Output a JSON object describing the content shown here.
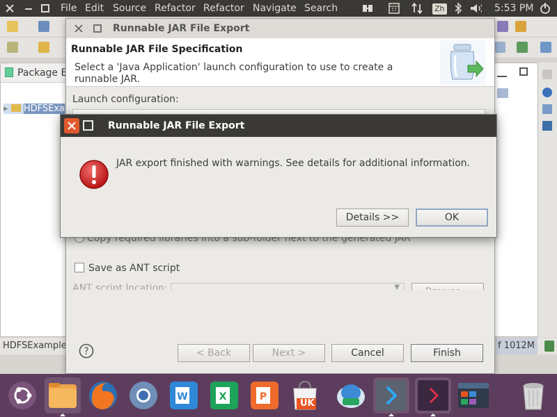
{
  "panel": {
    "menus": [
      "File",
      "Edit",
      "Source",
      "Refactor",
      "Refactor",
      "Navigate",
      "Search"
    ],
    "keyboard_layout": "Zh",
    "time": "5:53 PM",
    "indicator_icons": [
      "connect-icon",
      "calendar-icon",
      "network-arrows-icon",
      "keyboard-icon",
      "bluetooth-icon",
      "volume-icon",
      "power-icon"
    ]
  },
  "eclipse": {
    "package_explorer_tab": "Package E",
    "project_item": "HDFSExa",
    "status_left": "HDFSExample",
    "status_memory": "f 1012M"
  },
  "wizard": {
    "title": "Runnable JAR File Export",
    "heading": "Runnable JAR File Specification",
    "description": "Select a 'Java Application' launch configuration to use to create a runnable JAR.",
    "launch_config_label": "Launch configuration:",
    "copy_libs_radio": "Copy required libraries into a sub-folder next to the generated JAR",
    "save_ant_label": "Save as ANT script",
    "ant_location_label": "ANT script location:",
    "browse_label": "Browse...",
    "back_label": "< Back",
    "next_label": "Next >",
    "cancel_label": "Cancel",
    "finish_label": "Finish"
  },
  "message": {
    "title": "Runnable JAR File Export",
    "text": "JAR export finished with warnings. See details for additional information.",
    "details_label": "Details >>",
    "ok_label": "OK",
    "icon": "error-icon"
  },
  "dock": {
    "badge_text": "UK",
    "apps": [
      "ubuntu-dash-icon",
      "files-icon",
      "firefox-icon",
      "chromium-icon",
      "word-icon",
      "excel-icon",
      "powerpoint-icon",
      "ubuntu-store-icon",
      "remote-desktop-icon",
      "vscode-icon",
      "terminal-arrow-icon",
      "workspace-switcher-icon",
      "trash-icon"
    ]
  },
  "colors": {
    "panel_bg": "#3a3935",
    "dock_bg": "#5d3d5d",
    "close_orange": "#e0592c",
    "error_red": "#d91b1b"
  }
}
